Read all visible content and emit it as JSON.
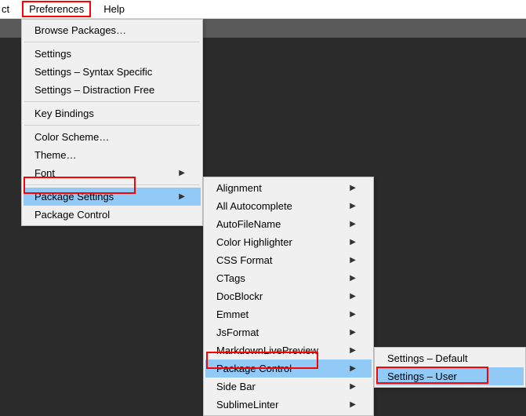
{
  "menubar": {
    "partial": "ct",
    "preferences": "Preferences",
    "help": "Help"
  },
  "menu1": {
    "browse_packages": "Browse Packages…",
    "settings": "Settings",
    "settings_syntax": "Settings – Syntax Specific",
    "settings_distraction": "Settings – Distraction Free",
    "key_bindings": "Key Bindings",
    "color_scheme": "Color Scheme…",
    "theme": "Theme…",
    "font": "Font",
    "package_settings": "Package Settings",
    "package_control": "Package Control"
  },
  "menu2": {
    "alignment": "Alignment",
    "all_autocomplete": "All Autocomplete",
    "autofilename": "AutoFileName",
    "color_highlighter": "Color Highlighter",
    "css_format": "CSS Format",
    "ctags": "CTags",
    "docblockr": "DocBlockr",
    "emmet": "Emmet",
    "jsformat": "JsFormat",
    "markdown_preview": "MarkdownLivePreview",
    "package_control": "Package Control",
    "side_bar": "Side Bar",
    "sublimelinter": "SublimeLinter"
  },
  "menu3": {
    "settings_default": "Settings – Default",
    "settings_user": "Settings – User"
  }
}
